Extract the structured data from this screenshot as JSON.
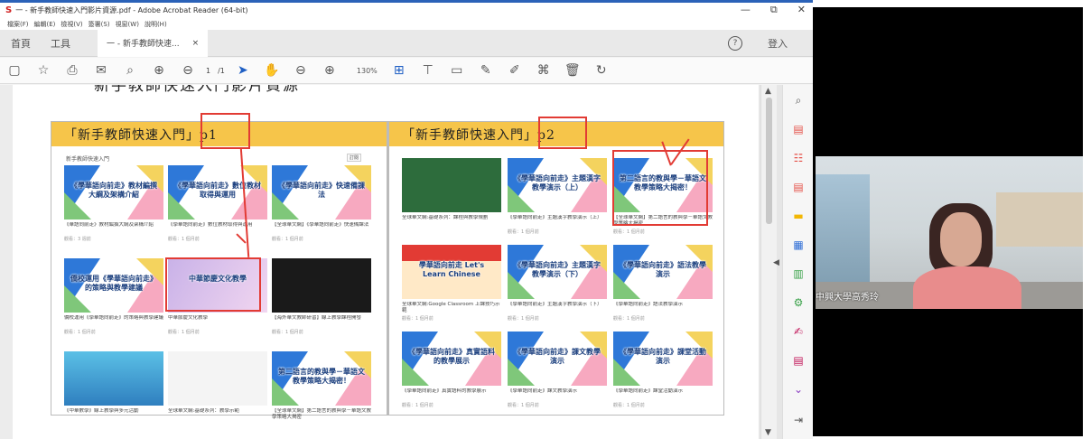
{
  "window": {
    "title": "一 - 新手教師快速入門影片資源.pdf - Adobe Acrobat Reader (64-bit)",
    "pdf_icon": "S",
    "controls": [
      "—",
      "⧉",
      "✕"
    ]
  },
  "menu": [
    "檔案(F)",
    "編輯(E)",
    "檢視(V)",
    "簽署(S)",
    "視窗(W)",
    "說明(H)"
  ],
  "tabs": {
    "home": "首頁",
    "tools": "工具",
    "doc": "一 - 新手教師快速...",
    "doc_close": "×",
    "help": "?",
    "signin": "登入"
  },
  "toolbar": {
    "page_current": "1",
    "page_total": "/1",
    "zoom": "130%",
    "icons": [
      "save-icon",
      "star-icon",
      "print-icon",
      "email-icon",
      "search-icon",
      "prev-page-icon",
      "next-page-icon",
      "select-icon",
      "hand-icon",
      "zoom-out-icon",
      "zoom-in-icon",
      "fit-icon",
      "scroll-icon",
      "comment-icon",
      "highlight-icon",
      "draw-icon",
      "stamp-icon",
      "delete-icon",
      "rotate-icon"
    ]
  },
  "page": {
    "heading": "新手教師快速入門影片資源",
    "panel_left": {
      "banner": "「新手教師快速入門」p1",
      "channel": "新手教師快速入門",
      "subscribe": "訂閱",
      "cards": [
        {
          "title": "《學華語向前走》教材編撰大綱及架構介紹",
          "caption": "《華語向前走》教材編撰大綱及架構介紹",
          "meta": "觀看：3 週前",
          "style": "tri"
        },
        {
          "title": "《學華語向前走》數位教材取得與運用",
          "caption": "《學華語向前走》數位教材取得與運用",
          "meta": "觀看：1 個月前",
          "style": "tri"
        },
        {
          "title": "《學華語向前走》快速備課法",
          "caption": "【全球華文網】《學華語向前走》快速備課法",
          "meta": "觀看：1 個月前",
          "style": "tri"
        },
        {
          "title": "僑校運用《學華語向前走》的策略與教學建議",
          "caption": "僑校運用《學華語向前走》的策略與教學建議",
          "meta": "觀看：1 個月前",
          "style": "tri"
        },
        {
          "title": "中華節慶文化教學",
          "caption": "中華節慶文化教學",
          "meta": "觀看：1 個月前",
          "style": "fest"
        },
        {
          "title": "",
          "caption": "【海外華文教師研習】線上教學課程開發",
          "meta": "觀看：1 個月前",
          "style": "dark"
        },
        {
          "title": "",
          "caption": "《中華數學》線上教學與多元活動",
          "meta": "",
          "style": "photo"
        },
        {
          "title": "",
          "caption": "全球華文網:基礎系列：教學示範",
          "meta": "",
          "style": "screen"
        },
        {
          "title": "第二語言的教與學－華語文教學策略大揭密！",
          "caption": "【全球華文網】第二語言的教與學－華語文教學策略大揭密",
          "meta": "",
          "style": "tri"
        }
      ]
    },
    "panel_right": {
      "banner": "「新手教師快速入門」p2",
      "cards": [
        {
          "title": "",
          "caption": "全球華文網:基礎系列：課程與教學規劃",
          "meta": "",
          "style": "green"
        },
        {
          "title": "《學華語向前走》主題漢字教學演示（上）",
          "caption": "《學華語向前走》主題漢字教學演示（上）",
          "meta": "觀看：1 個月前",
          "style": "tri"
        },
        {
          "title": "第二語言的教與學－華語文教學策略大揭密！",
          "caption": "【全球華文網】第二語言的教與學－華語文教學策略大揭密",
          "meta": "觀看：1 個月前",
          "style": "tri"
        },
        {
          "title": "學華語向前走 Let's Learn Chinese",
          "caption": "全球華文網:Google Classroom 上課技巧示範",
          "meta": "觀看：1 個月前",
          "style": "learn"
        },
        {
          "title": "《學華語向前走》主題漢字教學演示（下）",
          "caption": "《學華語向前走》主題漢字教學演示（下）",
          "meta": "觀看：1 個月前",
          "style": "tri"
        },
        {
          "title": "《學華語向前走》語法教學演示",
          "caption": "《學華語向前走》語法教學演示",
          "meta": "觀看：1 個月前",
          "style": "tri"
        },
        {
          "title": "《學華語向前走》真實語料的教學展示",
          "caption": "《學華語向前走》真實語料的教學展示",
          "meta": "觀看：1 個月前",
          "style": "tri"
        },
        {
          "title": "《學華語向前走》課文教學演示",
          "caption": "《學華語向前走》課文教學演示",
          "meta": "觀看：1 個月前",
          "style": "tri"
        },
        {
          "title": "《學華語向前走》課堂活動演示",
          "caption": "《學華語向前走》課堂活動演示",
          "meta": "觀看：1 個月前",
          "style": "tri"
        }
      ]
    }
  },
  "right_tools": [
    "zoom-tool-icon",
    "export-pdf-icon",
    "organize-icon",
    "create-pdf-icon",
    "comment-tool-icon",
    "edit-pdf-icon",
    "combine-icon",
    "protect-icon",
    "fill-sign-icon",
    "more-tools-icon",
    "expand-icon",
    "collapse-panel-icon"
  ],
  "webcam": {
    "label": "中興大學高秀玲"
  },
  "colors": {
    "banner": "#f6c54a",
    "red_annotation": "#e23b34",
    "acrobat_red": "#d02020"
  }
}
